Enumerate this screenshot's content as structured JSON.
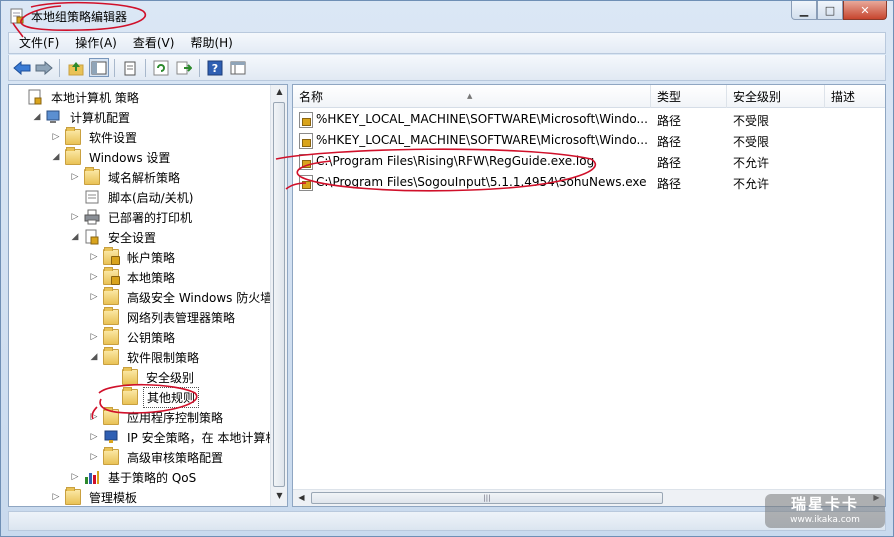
{
  "window": {
    "title": "本地组策略编辑器"
  },
  "menu": [
    "文件(F)",
    "操作(A)",
    "查看(V)",
    "帮助(H)"
  ],
  "toolbar": {
    "icons": [
      "back-arrow-icon",
      "forward-arrow-icon",
      "up-folder-icon",
      "show-hide-tree-icon",
      "properties-icon",
      "refresh-icon",
      "export-list-icon",
      "help-icon",
      "console-view-icon"
    ]
  },
  "tree": [
    {
      "label": "本地计算机 策略",
      "arrow": "",
      "icon": "computer-policy-icon",
      "indent": 0
    },
    {
      "label": "计算机配置",
      "arrow": "◢",
      "icon": "computer-icon",
      "indent": 1
    },
    {
      "label": "软件设置",
      "arrow": "▷",
      "icon": "folder-icon",
      "indent": 2
    },
    {
      "label": "Windows 设置",
      "arrow": "◢",
      "icon": "folder-icon",
      "indent": 2
    },
    {
      "label": "域名解析策略",
      "arrow": "▷",
      "icon": "folder-icon",
      "indent": 3
    },
    {
      "label": "脚本(启动/关机)",
      "arrow": "",
      "icon": "script-icon",
      "indent": 3
    },
    {
      "label": "已部署的打印机",
      "arrow": "▷",
      "icon": "printer-icon",
      "indent": 3
    },
    {
      "label": "安全设置",
      "arrow": "◢",
      "icon": "security-settings-icon",
      "indent": 3
    },
    {
      "label": "帐户策略",
      "arrow": "▷",
      "icon": "lock-folder-icon",
      "indent": 4
    },
    {
      "label": "本地策略",
      "arrow": "▷",
      "icon": "lock-folder-icon",
      "indent": 4
    },
    {
      "label": "高级安全 Windows 防火墙",
      "arrow": "▷",
      "icon": "folder-icon",
      "indent": 4
    },
    {
      "label": "网络列表管理器策略",
      "arrow": "",
      "icon": "folder-icon",
      "indent": 4
    },
    {
      "label": "公钥策略",
      "arrow": "▷",
      "icon": "folder-icon",
      "indent": 4
    },
    {
      "label": "软件限制策略",
      "arrow": "◢",
      "icon": "folder-icon",
      "indent": 4
    },
    {
      "label": "安全级别",
      "arrow": "",
      "icon": "folder-icon",
      "indent": 5
    },
    {
      "label": "其他规则",
      "arrow": "",
      "icon": "folder-icon",
      "indent": 5,
      "selected": true
    },
    {
      "label": "应用程序控制策略",
      "arrow": "▷",
      "icon": "folder-icon",
      "indent": 4
    },
    {
      "label": "IP 安全策略，在 本地计算机",
      "arrow": "▷",
      "icon": "ip-security-icon",
      "indent": 4
    },
    {
      "label": "高级审核策略配置",
      "arrow": "▷",
      "icon": "folder-icon",
      "indent": 4
    },
    {
      "label": "基于策略的 QoS",
      "arrow": "▷",
      "icon": "qos-chart-icon",
      "indent": 3
    },
    {
      "label": "管理模板",
      "arrow": "▷",
      "icon": "folder-icon",
      "indent": 2
    }
  ],
  "list": {
    "columns": [
      "名称",
      "类型",
      "安全级别",
      "描述"
    ],
    "rows": [
      {
        "name": "%HKEY_LOCAL_MACHINE\\SOFTWARE\\Microsoft\\Windo...",
        "type": "路径",
        "level": "不受限",
        "desc": ""
      },
      {
        "name": "%HKEY_LOCAL_MACHINE\\SOFTWARE\\Microsoft\\Windo...",
        "type": "路径",
        "level": "不受限",
        "desc": ""
      },
      {
        "name": "C:\\Program Files\\Rising\\RFW\\RegGuide.exe.log",
        "type": "路径",
        "level": "不允许",
        "desc": ""
      },
      {
        "name": "C:\\Program Files\\SogouInput\\5.1.1.4954\\SohuNews.exe",
        "type": "路径",
        "level": "不允许",
        "desc": ""
      }
    ]
  },
  "watermark": {
    "main": "瑞星卡卡",
    "sub": "www.ikaka.com"
  },
  "colors": {
    "annotation_red": "#d0102a",
    "window_frame": "#c9daee",
    "selection_border": "#555555"
  }
}
